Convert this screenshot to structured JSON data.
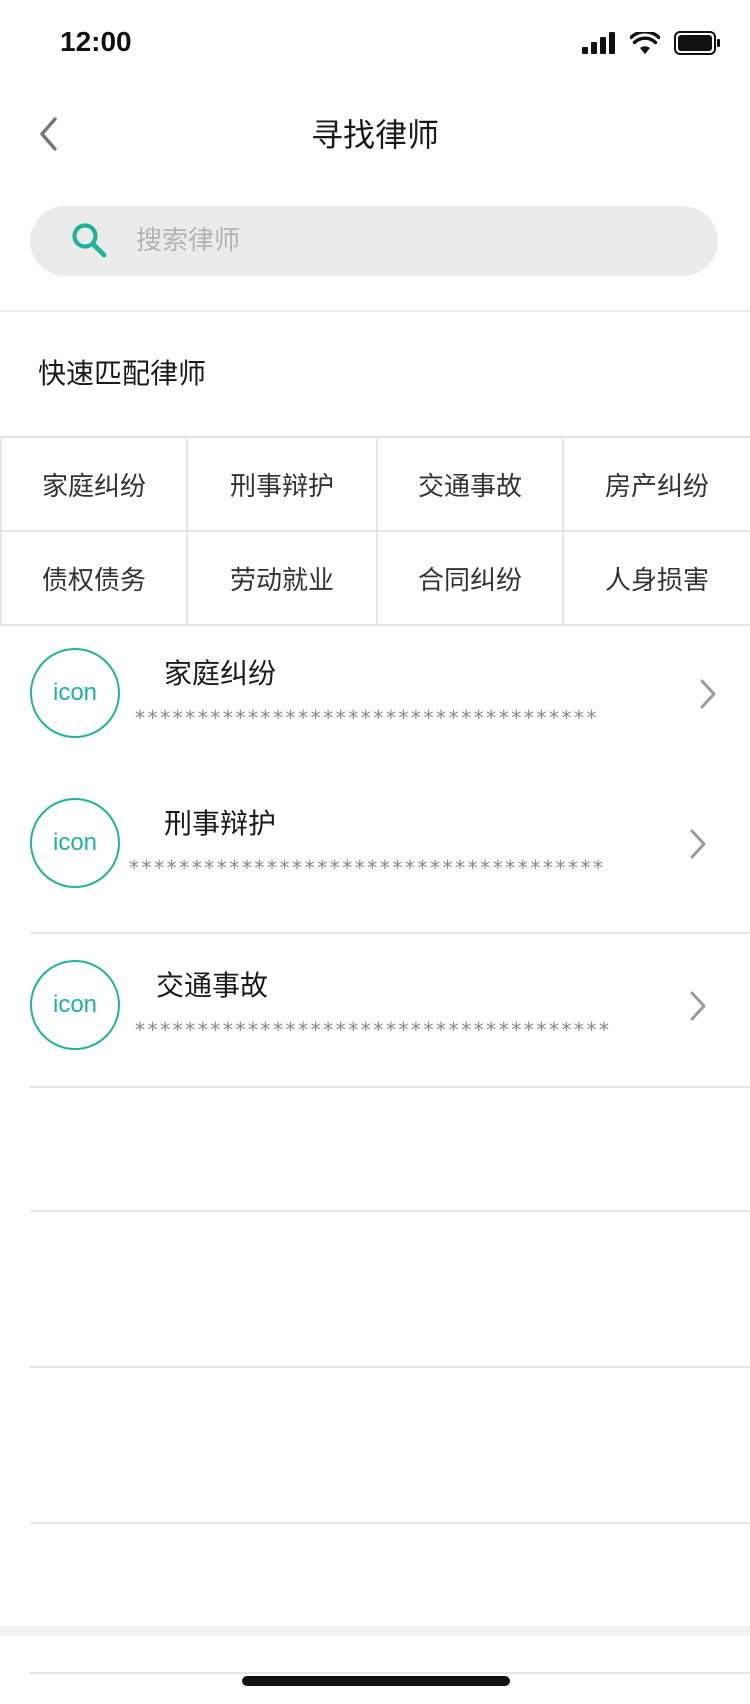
{
  "status_bar": {
    "time": "12:00"
  },
  "header": {
    "title": "寻找律师"
  },
  "search": {
    "placeholder": "搜索律师",
    "value": ""
  },
  "quick_match": {
    "title": "快速匹配律师",
    "categories": [
      "家庭纠纷",
      "刑事辩护",
      "交通事故",
      "房产纠纷",
      "债权债务",
      "劳动就业",
      "合同纠纷",
      "人身损害"
    ]
  },
  "list": {
    "items": [
      {
        "avatar_text": "icon",
        "title": "家庭纠纷",
        "description": "*************************************"
      },
      {
        "avatar_text": "icon",
        "title": "刑事辩护",
        "description": "**************************************"
      },
      {
        "avatar_text": "icon",
        "title": "交通事故",
        "description": "**************************************"
      }
    ]
  },
  "colors": {
    "accent": "#1fb39a",
    "search_bg": "#ebebeb",
    "divider": "#e6e6e6",
    "chevron": "#9a9a9a"
  },
  "icons": {
    "back": "chevron-left-icon",
    "search": "search-icon",
    "chevron": "chevron-right-icon",
    "signal": "signal-icon",
    "wifi": "wifi-icon",
    "battery": "battery-icon"
  }
}
